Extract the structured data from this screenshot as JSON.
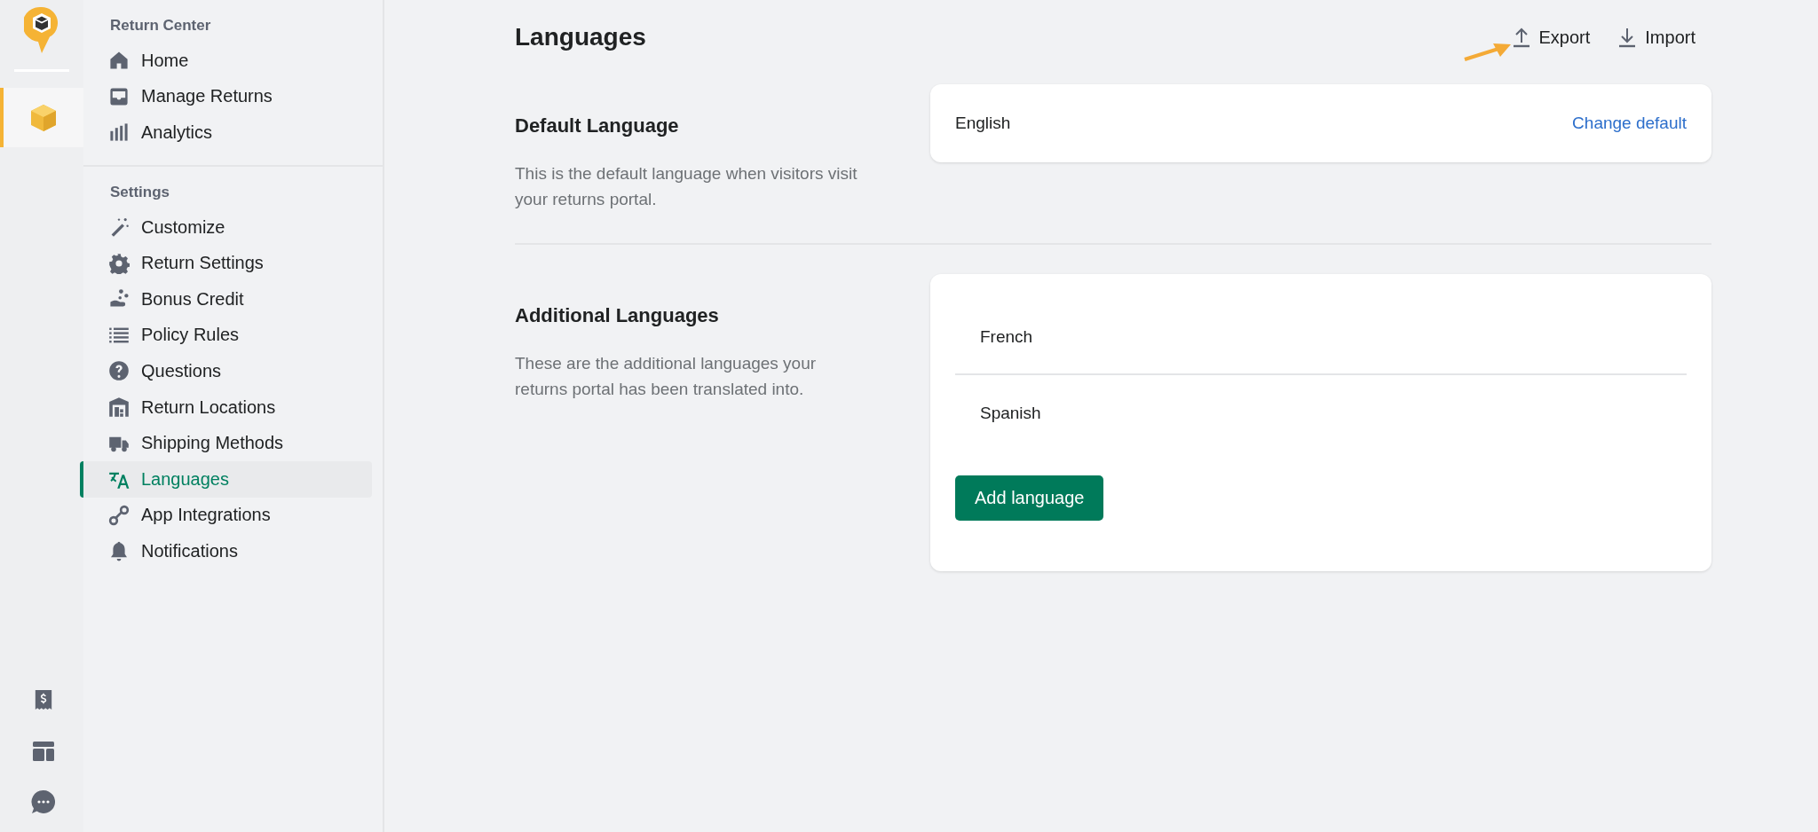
{
  "rail": {
    "items": [
      {
        "selected": true
      },
      {
        "selected": false
      },
      {
        "selected": false
      },
      {
        "selected": false
      }
    ]
  },
  "sidebar": {
    "sections": [
      {
        "title": "Return Center",
        "items": [
          {
            "label": "Home",
            "selected": false
          },
          {
            "label": "Manage Returns",
            "selected": false
          },
          {
            "label": "Analytics",
            "selected": false
          }
        ]
      },
      {
        "title": "Settings",
        "items": [
          {
            "label": "Customize",
            "selected": false
          },
          {
            "label": "Return Settings",
            "selected": false
          },
          {
            "label": "Bonus Credit",
            "selected": false
          },
          {
            "label": "Policy Rules",
            "selected": false
          },
          {
            "label": "Questions",
            "selected": false
          },
          {
            "label": "Return Locations",
            "selected": false
          },
          {
            "label": "Shipping Methods",
            "selected": false
          },
          {
            "label": "Languages",
            "selected": true
          },
          {
            "label": "App Integrations",
            "selected": false
          },
          {
            "label": "Notifications",
            "selected": false
          }
        ]
      }
    ]
  },
  "page": {
    "title": "Languages",
    "actions": [
      "Export",
      "Import"
    ]
  },
  "default_language": {
    "heading": "Default Language",
    "description": "This is the default language when visitors visit your returns portal.",
    "value": "English",
    "link": "Change default"
  },
  "additional_languages": {
    "heading": "Additional Languages",
    "description": "These are the additional languages your returns portal has been translated into.",
    "languages": [
      "French",
      "Spanish"
    ],
    "button": "Add language"
  }
}
